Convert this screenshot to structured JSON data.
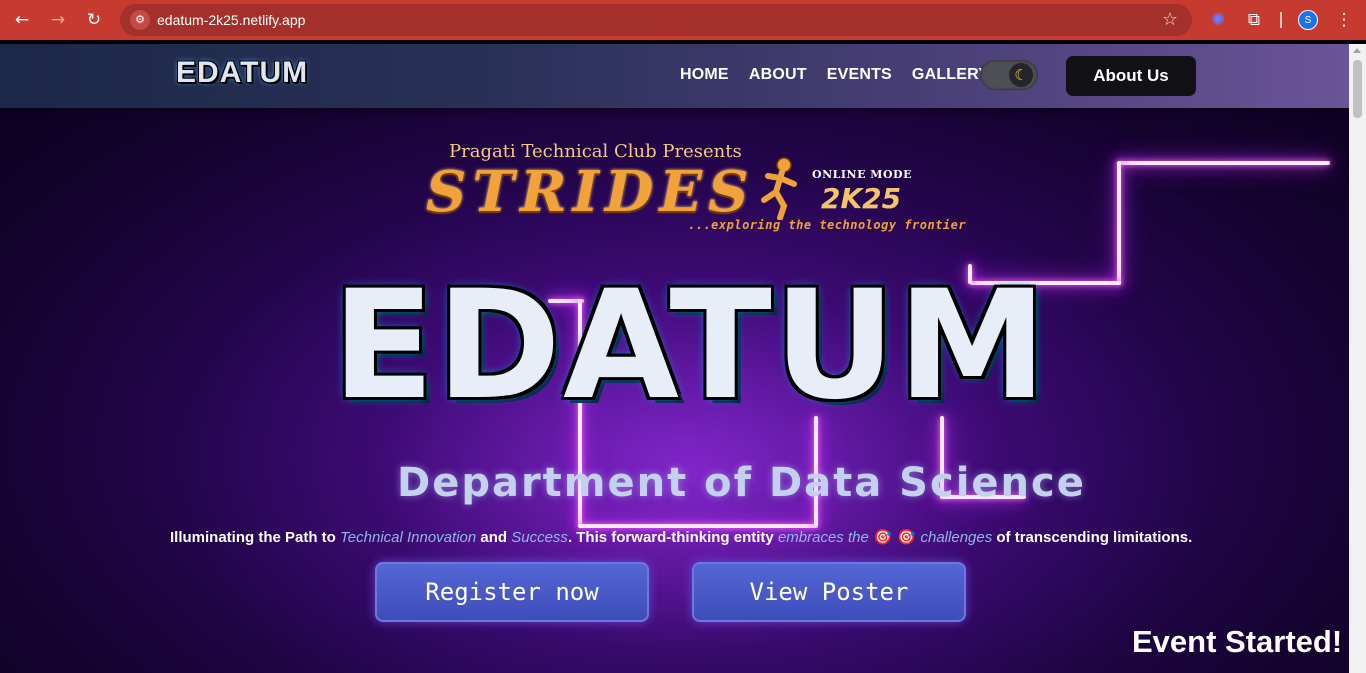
{
  "browser": {
    "url": "edatum-2k25.netlify.app",
    "profile_initial": "S",
    "icons": {
      "back": "back-arrow-icon",
      "forward": "forward-arrow-icon",
      "reload": "reload-icon",
      "site_info": "site-info-icon",
      "bookmark": "star-icon",
      "extension1": "gear-extension-icon",
      "extensions": "puzzle-icon",
      "menu": "kebab-menu-icon"
    }
  },
  "navbar": {
    "logo": "EDATUM",
    "links": [
      "HOME",
      "ABOUT",
      "EVENTS",
      "GALLERY"
    ],
    "theme_toggle_icon": "moon-icon",
    "about_button": "About Us"
  },
  "hero": {
    "presents": "Pragati Technical Club Presents",
    "event_name": "STRIDES",
    "mode": "ONLINE MODE",
    "year": "2K25",
    "tagline": "...exploring the technology frontier",
    "main_logo": "EDATUM",
    "department": "Department of Data Science",
    "description": {
      "part1": "Illuminating the Path to ",
      "highlight1": "Technical Innovation",
      "part2": " and ",
      "highlight2": "Success",
      "part3": ". This forward-thinking entity ",
      "highlight3": "embraces the",
      "emoji": " 🎯 🎯 ",
      "highlight4": "challenges",
      "part4": " of transcending limitations."
    },
    "register_button": "Register now",
    "poster_button": "View Poster",
    "status": "Event Started!"
  },
  "colors": {
    "browser_bar": "#c63a30",
    "accent_button": "#4a5ac8",
    "neon": "#d43cff",
    "highlight_text": "#8fb7e8"
  }
}
